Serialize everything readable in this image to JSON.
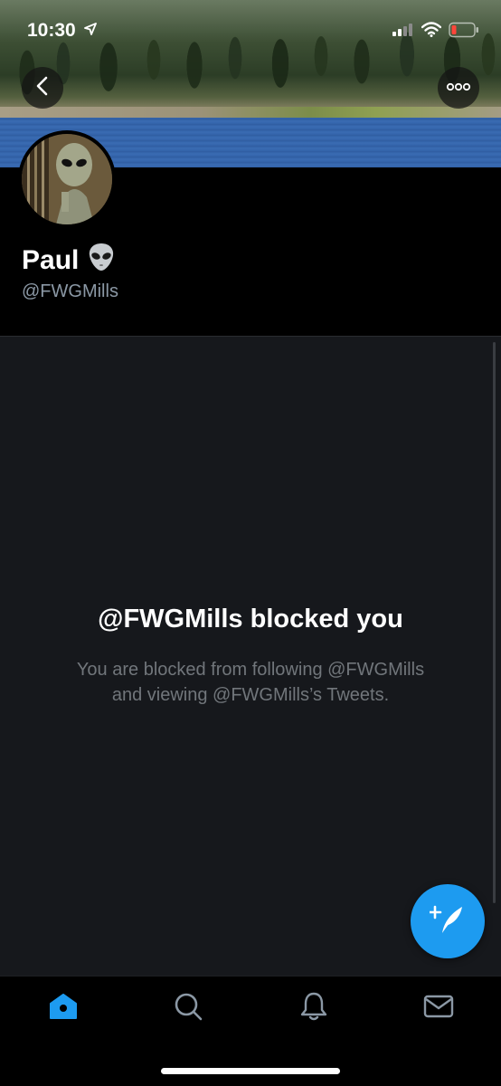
{
  "status_bar": {
    "time": "10:30",
    "battery_color": "#ff453a"
  },
  "profile": {
    "name": "Paul",
    "handle": "@FWGMills"
  },
  "blocked": {
    "title": "@FWGMills blocked you",
    "line1": "You are blocked from following @FWGMills",
    "line2": "and viewing @FWGMills’s Tweets."
  },
  "icons": {
    "back": "chevron-left-icon",
    "more": "more-icon",
    "compose": "compose-tweet-icon",
    "home": "home-icon",
    "search": "search-icon",
    "notifications": "bell-icon",
    "messages": "mail-icon"
  },
  "colors": {
    "accent": "#1d9bf0",
    "background": "#16181c",
    "secondary_text": "#71767b",
    "nav_inactive": "#8b98a5"
  }
}
